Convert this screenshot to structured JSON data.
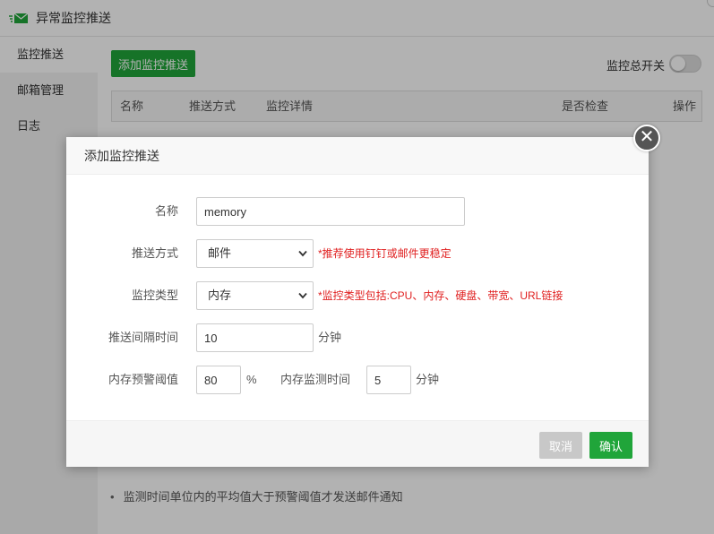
{
  "window": {
    "title": "异常监控推送",
    "icon": "mail-send-icon"
  },
  "sidebar": {
    "items": [
      {
        "label": "监控推送"
      },
      {
        "label": "邮箱管理"
      },
      {
        "label": "日志"
      }
    ]
  },
  "main": {
    "add_button": "添加监控推送",
    "master_switch_label": "监控总开关",
    "master_switch_on": false,
    "table_headers": [
      "名称",
      "推送方式",
      "监控详情",
      "是否检查",
      "操作"
    ],
    "note": "监测时间单位内的平均值大于预警阈值才发送邮件通知"
  },
  "modal": {
    "title": "添加监控推送",
    "fields": {
      "name": {
        "label": "名称",
        "value": "memory"
      },
      "push_method": {
        "label": "推送方式",
        "value": "邮件",
        "hint": "*推荐使用钉钉或邮件更稳定"
      },
      "monitor_type": {
        "label": "监控类型",
        "value": "内存",
        "hint": "*监控类型包括:CPU、内存、硬盘、带宽、URL链接"
      },
      "interval": {
        "label": "推送间隔时间",
        "value": "10",
        "unit": "分钟"
      },
      "threshold": {
        "label": "内存预警阈值",
        "value": "80",
        "unit": "%"
      },
      "monitor_time": {
        "label": "内存监测时间",
        "value": "5",
        "unit": "分钟"
      }
    },
    "cancel_label": "取消",
    "confirm_label": "确认"
  },
  "colors": {
    "accent": "#20a53a",
    "hint": "#e02020",
    "cancel": "#c8c8c8"
  }
}
